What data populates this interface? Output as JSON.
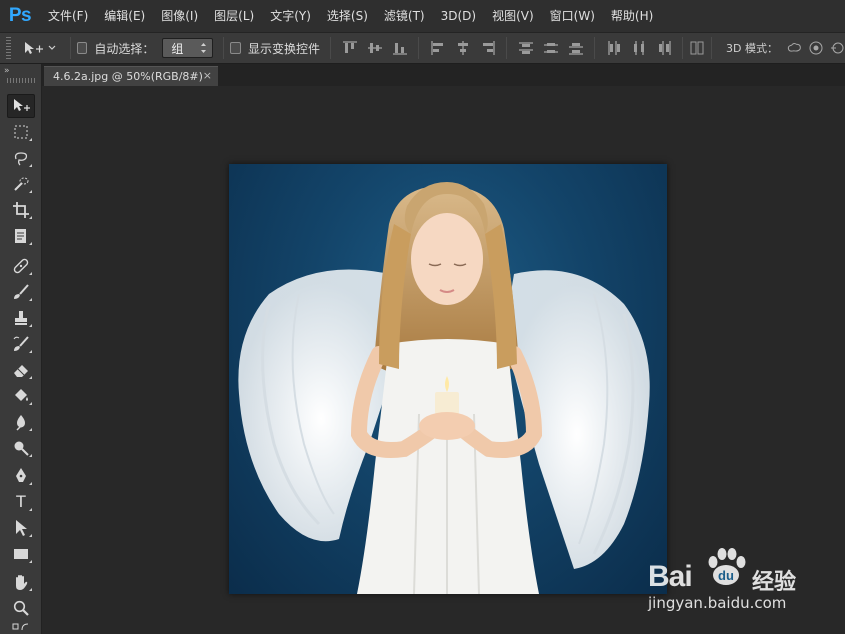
{
  "app": {
    "logo": "Ps",
    "accent": "#31a8ff"
  },
  "menubar": {
    "items": [
      "文件(F)",
      "编辑(E)",
      "图像(I)",
      "图层(L)",
      "文字(Y)",
      "选择(S)",
      "滤镜(T)",
      "3D(D)",
      "视图(V)",
      "窗口(W)",
      "帮助(H)"
    ]
  },
  "options": {
    "tool_icon": "move-tool-icon",
    "auto_select_label": "自动选择：",
    "auto_select_checked": false,
    "auto_select_value": "组",
    "show_transform_label": "显示变换控件",
    "show_transform_checked": false,
    "mode_3d_label": "3D 模式："
  },
  "document": {
    "tab_title": "4.6.2a.jpg @ 50%(RGB/8#)",
    "close_glyph": "×"
  },
  "toolbox": {
    "collapse_glyph": "»",
    "tools": [
      {
        "name": "move-tool",
        "active": true
      },
      {
        "name": "rectangular-marquee-tool"
      },
      {
        "name": "lasso-tool"
      },
      {
        "name": "quick-selection-tool"
      },
      {
        "name": "crop-tool"
      },
      {
        "name": "eyedropper-tool"
      },
      {
        "name": "spot-healing-brush-tool"
      },
      {
        "name": "brush-tool"
      },
      {
        "name": "clone-stamp-tool"
      },
      {
        "name": "history-brush-tool"
      },
      {
        "name": "eraser-tool"
      },
      {
        "name": "paint-bucket-tool"
      },
      {
        "name": "blur-tool"
      },
      {
        "name": "dodge-tool"
      },
      {
        "name": "pen-tool"
      },
      {
        "name": "type-tool",
        "glyph": "T"
      },
      {
        "name": "path-selection-tool"
      },
      {
        "name": "rectangle-tool"
      },
      {
        "name": "hand-tool"
      },
      {
        "name": "zoom-tool"
      }
    ]
  },
  "watermark": {
    "brand": "Bai",
    "brand_suffix": "经验",
    "url": "jingyan.baidu.com"
  }
}
